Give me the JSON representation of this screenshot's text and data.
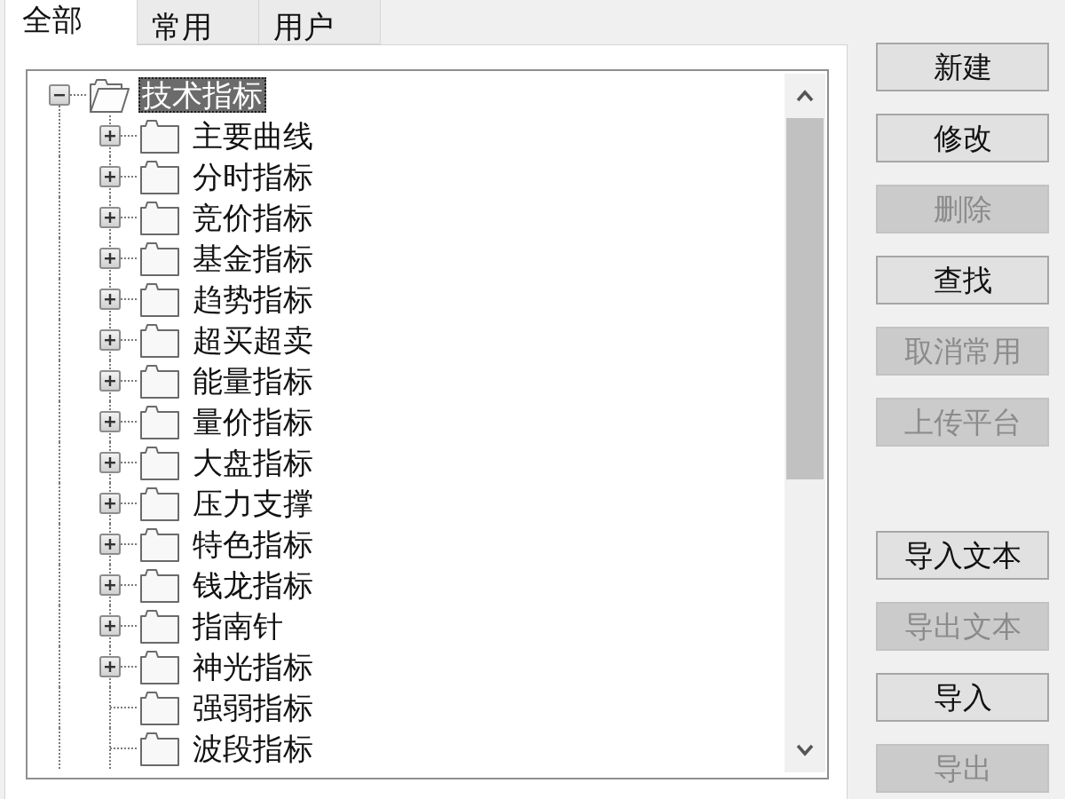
{
  "tabs": [
    {
      "label": "全部",
      "selected": true
    },
    {
      "label": "常用",
      "selected": false
    },
    {
      "label": "用户",
      "selected": false
    }
  ],
  "tree": {
    "items": [
      {
        "label": "技术指标",
        "selected": true,
        "expandable": true,
        "expanded": true,
        "children": [
          {
            "label": "主要曲线",
            "selected": false,
            "expandable": true,
            "expanded": false
          },
          {
            "label": "分时指标",
            "selected": false,
            "expandable": true,
            "expanded": false
          },
          {
            "label": "竞价指标",
            "selected": false,
            "expandable": true,
            "expanded": false
          },
          {
            "label": "基金指标",
            "selected": false,
            "expandable": true,
            "expanded": false
          },
          {
            "label": "趋势指标",
            "selected": false,
            "expandable": true,
            "expanded": false
          },
          {
            "label": "超买超卖",
            "selected": false,
            "expandable": true,
            "expanded": false
          },
          {
            "label": "能量指标",
            "selected": false,
            "expandable": true,
            "expanded": false
          },
          {
            "label": "量价指标",
            "selected": false,
            "expandable": true,
            "expanded": false
          },
          {
            "label": "大盘指标",
            "selected": false,
            "expandable": true,
            "expanded": false
          },
          {
            "label": "压力支撑",
            "selected": false,
            "expandable": true,
            "expanded": false
          },
          {
            "label": "特色指标",
            "selected": false,
            "expandable": true,
            "expanded": false
          },
          {
            "label": "钱龙指标",
            "selected": false,
            "expandable": true,
            "expanded": false
          },
          {
            "label": "指南针",
            "selected": false,
            "expandable": true,
            "expanded": false
          },
          {
            "label": "神光指标",
            "selected": false,
            "expandable": true,
            "expanded": false
          },
          {
            "label": "强弱指标",
            "selected": false,
            "expandable": false,
            "expanded": false
          },
          {
            "label": "波段指标",
            "selected": false,
            "expandable": false,
            "expanded": false
          }
        ]
      }
    ]
  },
  "buttons_top": [
    {
      "label": "新建",
      "disabled": false
    },
    {
      "label": "修改",
      "disabled": false
    },
    {
      "label": "删除",
      "disabled": true
    },
    {
      "label": "查找",
      "disabled": false
    },
    {
      "label": "取消常用",
      "disabled": true
    },
    {
      "label": "上传平台",
      "disabled": true
    }
  ],
  "buttons_bottom": [
    {
      "label": "导入文本",
      "disabled": false
    },
    {
      "label": "导出文本",
      "disabled": true
    },
    {
      "label": "导入",
      "disabled": false
    },
    {
      "label": "导出",
      "disabled": true
    }
  ]
}
